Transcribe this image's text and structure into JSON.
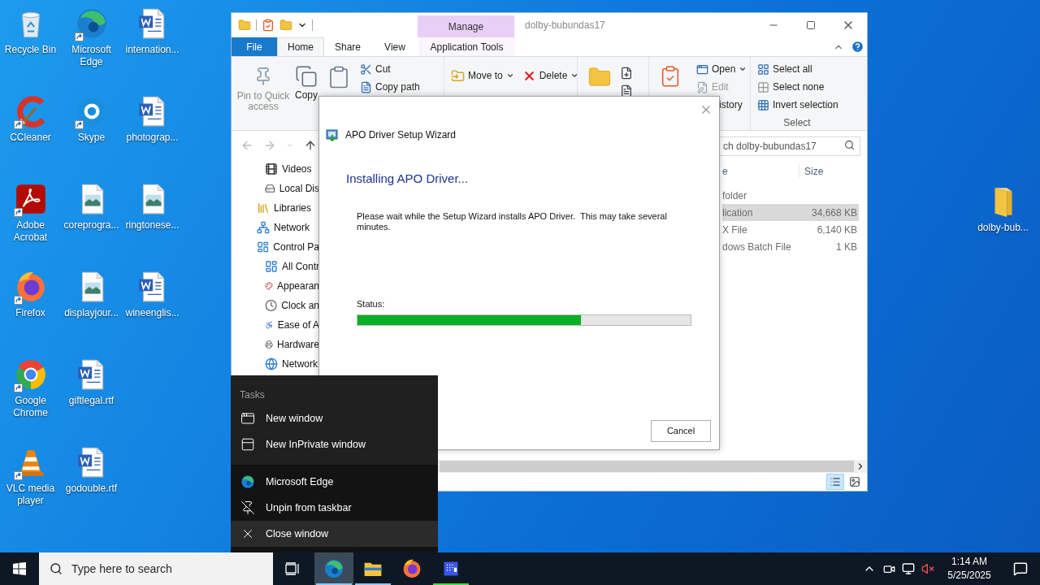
{
  "desktop": {
    "icons": [
      {
        "label": "Recycle Bin",
        "kind": "recycle",
        "shortcut": false
      },
      {
        "label": "CCleaner",
        "kind": "ccleaner",
        "shortcut": true
      },
      {
        "label": "Adobe Acrobat",
        "kind": "acrobat",
        "shortcut": true
      },
      {
        "label": "Firefox",
        "kind": "firefox",
        "shortcut": true
      },
      {
        "label": "Google Chrome",
        "kind": "chrome",
        "shortcut": true
      },
      {
        "label": "VLC media player",
        "kind": "vlc",
        "shortcut": true
      },
      {
        "label": "Microsoft Edge",
        "kind": "edge",
        "shortcut": true
      },
      {
        "label": "Skype",
        "kind": "skype",
        "shortcut": true
      },
      {
        "label": "coreprogra...",
        "kind": "image",
        "shortcut": false
      },
      {
        "label": "displayjour...",
        "kind": "image",
        "shortcut": false
      },
      {
        "label": "giftlegal.rtf",
        "kind": "word",
        "shortcut": false
      },
      {
        "label": "godouble.rtf",
        "kind": "word",
        "shortcut": false
      },
      {
        "label": "internation...",
        "kind": "word",
        "shortcut": false
      },
      {
        "label": "photograp...",
        "kind": "word",
        "shortcut": false
      },
      {
        "label": "ringtonese...",
        "kind": "image",
        "shortcut": false
      },
      {
        "label": "wineenglis...",
        "kind": "word",
        "shortcut": false
      }
    ],
    "right_icons": [
      {
        "label": "dolby-bub...",
        "kind": "folder",
        "shortcut": false
      }
    ]
  },
  "explorer": {
    "context_tab": "Manage",
    "title": "dolby-bubundas17",
    "tabs": [
      {
        "label": "File",
        "kind": "file",
        "selected": false
      },
      {
        "label": "Home",
        "kind": "tab",
        "selected": true
      },
      {
        "label": "Share",
        "kind": "tab",
        "selected": false
      },
      {
        "label": "View",
        "kind": "tab",
        "selected": false
      },
      {
        "label": "Application Tools",
        "kind": "context",
        "selected": false
      }
    ],
    "ribbon": {
      "large_commands": [
        {
          "label": "Pin to Quick access",
          "disabled": true
        },
        {
          "label": "Copy",
          "disabled": false
        }
      ],
      "clipboard_commands": [
        {
          "label": "Cut"
        },
        {
          "label": "Copy path"
        }
      ],
      "organize_commands": [
        {
          "label": "Move to",
          "dropdown": true
        },
        {
          "label": "Delete",
          "dropdown": true
        }
      ],
      "open_commands": [
        {
          "label": "Open",
          "dropdown": true,
          "disabled": false
        },
        {
          "label": "Edit",
          "dropdown": false,
          "disabled": true
        },
        {
          "label": "istory",
          "dropdown": false,
          "disabled": false
        }
      ],
      "select_commands": [
        {
          "label": "Select all"
        },
        {
          "label": "Select none"
        },
        {
          "label": "Invert selection"
        }
      ],
      "select_group_label": "Select"
    },
    "search": {
      "placeholder": "ch dolby-bubundas17"
    },
    "nav_pane": [
      {
        "children": [
          {
            "label": "Videos"
          },
          {
            "label": "Local Dis"
          }
        ]
      },
      {
        "label": "Libraries"
      },
      {
        "label": "Network"
      },
      {
        "label": "Control Pa",
        "children": [
          {
            "label": "All Contr"
          },
          {
            "label": "Appearan"
          },
          {
            "label": "Clock an"
          },
          {
            "label": "Ease of A"
          },
          {
            "label": "Hardware"
          },
          {
            "label": "Network"
          }
        ]
      }
    ],
    "columns": [
      "e",
      "Size"
    ],
    "rows": [
      {
        "column_1": "folder",
        "selected": false
      },
      {
        "column_1": "lication",
        "size": "34,668 KB",
        "selected": true
      },
      {
        "column_1": "X File",
        "size": "6,140 KB",
        "selected": false
      },
      {
        "column_1": "dows Batch File",
        "size": "1 KB",
        "selected": false
      }
    ],
    "views": [
      {
        "kind": "details",
        "selected": true
      },
      {
        "kind": "large_icons",
        "selected": false
      }
    ]
  },
  "dialog": {
    "title": "APO Driver Setup Wizard",
    "heading": "Installing APO Driver...",
    "message": "Please wait while the Setup Wizard installs APO Driver.  This may take several minutes.",
    "status_label": "Status:",
    "progress": {
      "level": 0.67
    },
    "buttons": [
      "Cancel"
    ]
  },
  "jump_list": {
    "header": "Tasks",
    "tasks": [
      {
        "label": "New window"
      },
      {
        "label": "New InPrivate window"
      }
    ],
    "actions": [
      {
        "label": "Microsoft Edge",
        "selected": false
      },
      {
        "label": "Unpin from taskbar",
        "selected": false
      },
      {
        "label": "Close window",
        "selected": true
      }
    ]
  },
  "taskbar": {
    "search": {
      "placeholder": "Type here to search"
    },
    "apps": [
      {
        "kind": "edge",
        "selected": true,
        "running": true
      },
      {
        "kind": "explorer",
        "selected": false,
        "running": true
      },
      {
        "kind": "firefox",
        "selected": false,
        "running": false
      },
      {
        "kind": "app",
        "selected": false,
        "running": true
      }
    ],
    "clock": {
      "time": "1:14 AM",
      "date": "5/25/2025"
    }
  }
}
